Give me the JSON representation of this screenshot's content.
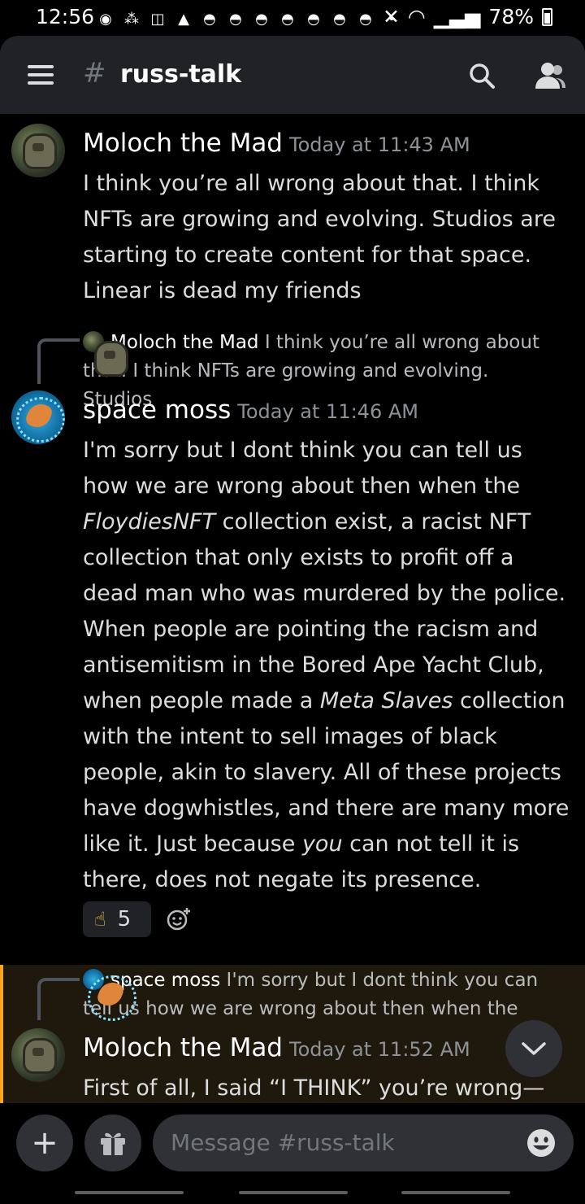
{
  "status_bar": {
    "time": "12:56",
    "battery": "78%"
  },
  "header": {
    "hash": "#",
    "channel": "russ-talk"
  },
  "messages": [
    {
      "author": "Moloch the Mad",
      "time": "Today at 11:43 AM",
      "text": "I think you’re all wrong about that. I think NFTs are growing and evolving. Studios are starting to create content for that space. Linear is dead my friends"
    },
    {
      "reply_author": "Moloch the Mad",
      "reply_text": "I think you’re all wrong about that. I think NFTs are growing and evolving. Studios",
      "author": "space moss",
      "time": "Today at 11:46 AM",
      "text_1": "I'm sorry but I dont think you can tell us how we are wrong about then when the ",
      "italic_1": "FloydiesNFT",
      "text_2": " collection exist, a racist NFT collection that only exists to profit off a dead man who was murdered by the police. When people are pointing the racism and antisemitism in the Bored Ape Yacht Club, when people made a ",
      "italic_2": "Meta Slaves",
      "text_3": " collection with the intent to sell images of black people, akin to slavery. All of these projects have dogwhistles, and there are many more like it. Just because ",
      "italic_3": "you",
      "text_4": " can not tell it is there, does not negate its presence.",
      "reaction_count": "5"
    },
    {
      "reply_author": "space moss",
      "reply_text": "I'm sorry but I dont think you can tell us how we are wrong about then when the",
      "author": "Moloch the Mad",
      "time": "Today at 11:52 AM",
      "text": "First of all, I said “I THINK” you’re wrong—not"
    }
  ],
  "composer": {
    "placeholder": "Message #russ-talk"
  },
  "colors": {
    "background": "#000000",
    "header": "#202225",
    "highlight_bar": "#faa81a",
    "input": "#2f3136"
  },
  "icons": [
    "menu-icon",
    "search-icon",
    "members-icon",
    "add-reaction-icon",
    "chevron-down-icon",
    "plus-icon",
    "gift-icon",
    "emoji-icon"
  ]
}
